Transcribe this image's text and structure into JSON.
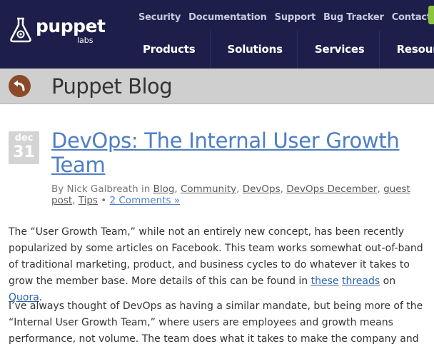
{
  "logo": {
    "word": "puppet",
    "sub": "labs"
  },
  "topnav": [
    "Security",
    "Documentation",
    "Support",
    "Bug Tracker",
    "Contact Us"
  ],
  "mainnav": [
    "Products",
    "Solutions",
    "Services",
    "Resources"
  ],
  "blog": {
    "title": "Puppet Blog"
  },
  "post": {
    "month": "dec",
    "day": "31",
    "title": "DevOps: The Internal User Growth Team",
    "meta": {
      "by": "By Nick Galbreath in",
      "categories": [
        "Blog",
        "Community",
        "DevOps",
        "DevOps December",
        "guest post",
        "Tips"
      ],
      "comments": "2 Comments »"
    },
    "p1": {
      "text": "The “User Growth Team,” while not an entirely new concept, has been recently popularized by some articles on Facebook. This team works somewhat out-of-band of traditional marketing, product, and business cycles to do whatever it takes to grow the member base. More details of this can be found in",
      "link1": "these",
      "link2": "threads",
      "on": "on",
      "link3": "Quora",
      "end": "."
    },
    "p2": {
      "text": "I’ve always thought of DevOps as having a similar mandate, but being more of the “Internal User Growth Team,” where users are employees and growth means performance, not volume. The team does what it takes to make the company and its"
    }
  },
  "colors": {
    "header": "#1d1f4a",
    "link": "#4e7ec4",
    "accent_green": "#8cc63f",
    "back_button": "#8a4a2a"
  }
}
